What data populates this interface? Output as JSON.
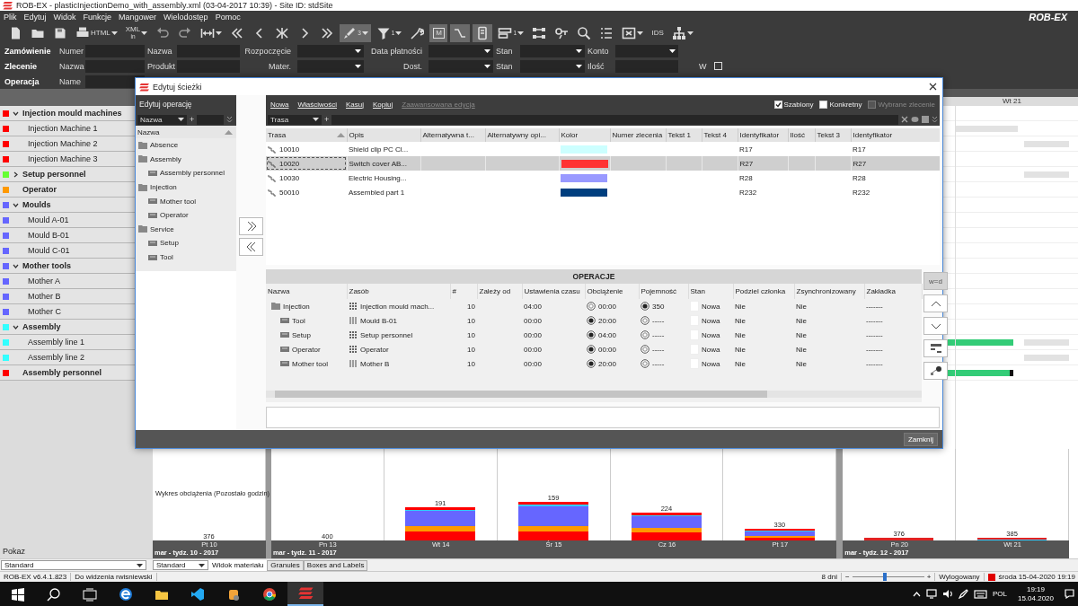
{
  "window": {
    "title": "ROB-EX - plasticInjectionDemo_with_assembly.xml (03-04-2017 10:39) - Site ID: stdSite"
  },
  "menu": {
    "items": [
      "Plik",
      "Edytuj",
      "Widok",
      "Funkcje",
      "Mangower",
      "Wielodostęp",
      "Pomoc"
    ],
    "logo": "ROB-EX"
  },
  "toolbar": [
    {
      "kind": "file",
      "on": false
    },
    {
      "kind": "folder",
      "on": false
    },
    {
      "kind": "save",
      "on": false
    },
    {
      "kind": "print",
      "text": "HTML",
      "dropdown": true,
      "on": false
    },
    {
      "kind": "xml",
      "text": "XML",
      "subtext": "in",
      "dropdown": true,
      "on": false
    },
    {
      "kind": "undo",
      "on": false
    },
    {
      "kind": "redo",
      "on": false
    },
    {
      "kind": "fit",
      "dropdown": true,
      "on": false
    },
    {
      "kind": "first",
      "on": false
    },
    {
      "kind": "prev",
      "on": false
    },
    {
      "kind": "center",
      "on": false
    },
    {
      "kind": "next",
      "on": false
    },
    {
      "kind": "last",
      "on": false
    },
    {
      "kind": "brush",
      "subtext": "3",
      "dropdown": true,
      "on": true
    },
    {
      "kind": "filter",
      "subtext": "1",
      "dropdown": true,
      "on": false
    },
    {
      "kind": "wrench",
      "on": false
    },
    {
      "kind": "mbox",
      "text": "M",
      "on": true
    },
    {
      "kind": "link",
      "on": true
    },
    {
      "kind": "phone",
      "on": true
    },
    {
      "kind": "list",
      "subtext": "1",
      "dropdown": true,
      "on": false
    },
    {
      "kind": "nodes",
      "on": false
    },
    {
      "kind": "key",
      "on": false
    },
    {
      "kind": "zoom",
      "on": false
    },
    {
      "kind": "list2",
      "on": false
    },
    {
      "kind": "frame",
      "dropdown": true,
      "on": false
    },
    {
      "kind": "ids",
      "text": "IDS",
      "on": false
    },
    {
      "kind": "tree",
      "dropdown": true,
      "on": false
    }
  ],
  "filters": [
    {
      "title": "Zamówienie",
      "fields": [
        {
          "label": "Numer",
          "kind": "text"
        },
        {
          "label": "Nazwa",
          "kind": "text"
        },
        {
          "label": "Rozpoczęcie",
          "kind": "dropdown"
        },
        {
          "label": "Data płatności",
          "kind": "dropdown"
        },
        {
          "label": "Stan",
          "kind": "dropdown"
        },
        {
          "label": "Konto",
          "kind": "dropdown"
        }
      ]
    },
    {
      "title": "Zlecenie",
      "fields": [
        {
          "label": "Nazwa",
          "kind": "text"
        },
        {
          "label": "Produkt",
          "kind": "text"
        },
        {
          "label": "Mater.",
          "kind": "dropdown"
        },
        {
          "label": "Dost.",
          "kind": "dropdown"
        },
        {
          "label": "Stan",
          "kind": "dropdown"
        },
        {
          "label": "Ilość",
          "kind": "text"
        },
        {
          "label": "W",
          "kind": "checkbox",
          "checked": false
        }
      ]
    },
    {
      "title": "Operacja",
      "fields": [
        {
          "label": "Name",
          "kind": "text"
        }
      ]
    }
  ],
  "resources": [
    {
      "name": "Injection mould machines",
      "color": "#ff0000",
      "expanded": true,
      "children": [
        {
          "name": "Injection Machine 1",
          "color": "#ff0000"
        },
        {
          "name": "Injection Machine 2",
          "color": "#ff0000"
        },
        {
          "name": "Injection Machine 3",
          "color": "#ff0000"
        }
      ]
    },
    {
      "name": "Setup personnel",
      "color": "#66ff33",
      "expanded": false
    },
    {
      "name": "Operator",
      "color": "#ff9900"
    },
    {
      "name": "Moulds",
      "color": "#6666ff",
      "expanded": true,
      "children": [
        {
          "name": "Mould A-01",
          "color": "#6666ff"
        },
        {
          "name": "Mould B-01",
          "color": "#6666ff"
        },
        {
          "name": "Mould C-01",
          "color": "#6666ff"
        }
      ]
    },
    {
      "name": "Mother tools",
      "color": "#6666ff",
      "expanded": true,
      "children": [
        {
          "name": "Mother A",
          "color": "#6666ff"
        },
        {
          "name": "Mother B",
          "color": "#6666ff"
        },
        {
          "name": "Mother C",
          "color": "#6666ff"
        }
      ]
    },
    {
      "name": "Assembly",
      "color": "#33ffff",
      "expanded": true,
      "children": [
        {
          "name": "Assembly line 1",
          "color": "#33ffff"
        },
        {
          "name": "Assembly line 2",
          "color": "#33ffff"
        }
      ]
    },
    {
      "name": "Assembly personnel",
      "color": "#ff0000"
    }
  ],
  "left_panel": {
    "label": "Pokaz",
    "dropdown": "Standard"
  },
  "gantt": {
    "day": "Wt 21"
  },
  "chart": {
    "title": "Wykres obciążenia (Pozostało godzin)",
    "weeks": [
      {
        "label": "mar - tydz. 10 - 2017",
        "days": [
          {
            "label": "Pt 10",
            "remaining": "376"
          }
        ]
      },
      {
        "label": "mar - tydz. 11 - 2017",
        "days": [
          {
            "label": "Pn 13",
            "remaining": "400"
          },
          {
            "label": "Wt 14",
            "remaining": "191"
          },
          {
            "label": "Śr 15",
            "remaining": "159"
          },
          {
            "label": "Cz 16",
            "remaining": "224"
          },
          {
            "label": "Pt 17",
            "remaining": "330"
          }
        ]
      },
      {
        "label": "mar - tydz. 12 - 2017",
        "days": [
          {
            "label": "Pn 20",
            "remaining": "376"
          },
          {
            "label": "Wt 21",
            "remaining": "385"
          }
        ]
      }
    ]
  },
  "view_tabs": {
    "dropdown": "Standard",
    "tabs": [
      {
        "label": "Widok materiału",
        "selected": true
      },
      {
        "label": "Granules",
        "selected": false
      },
      {
        "label": "Boxes and Labels",
        "selected": false
      }
    ]
  },
  "status_bar": {
    "version": "ROB-EX v6.4.1.823",
    "message": "Do widzenia rwisniewski",
    "range": "8 dni",
    "zoom_out": "−",
    "zoom_in": "+",
    "zoom": {
      "level": 0.45
    },
    "login": "Wylogowany",
    "datetime": "środa 15-04-2020 19:19"
  },
  "taskbar": {
    "buttons": [
      {
        "kind": "windows",
        "selected": false
      },
      {
        "kind": "search",
        "selected": false
      },
      {
        "kind": "taskview",
        "selected": false
      },
      {
        "kind": "edge",
        "selected": false
      },
      {
        "kind": "explorer",
        "selected": false
      },
      {
        "kind": "vscode",
        "selected": false
      },
      {
        "kind": "misc",
        "selected": false
      },
      {
        "kind": "chrome",
        "selected": false
      },
      {
        "kind": "robex",
        "selected": true
      }
    ],
    "language": "POL",
    "time": "19:19",
    "date": "15.04.2020"
  },
  "dialog": {
    "title": "Edytuj ścieżki",
    "left": {
      "header": "Edytuj operację",
      "dropdown": "Nazwa",
      "add": "+",
      "column": "Nazwa",
      "tree": [
        {
          "label": "Absence"
        },
        {
          "label": "Assembly",
          "children": [
            {
              "label": "Assembly personnel"
            }
          ]
        },
        {
          "label": "Injection",
          "children": [
            {
              "label": "Mother tool"
            },
            {
              "label": "Operator"
            }
          ]
        },
        {
          "label": "Service",
          "children": [
            {
              "label": "Setup"
            },
            {
              "label": "Tool"
            }
          ]
        }
      ]
    },
    "routes": {
      "actions": [
        {
          "label": "Nowa",
          "disabled": false
        },
        {
          "label": "Właściwości",
          "disabled": false
        },
        {
          "label": "Kasuj",
          "disabled": false
        },
        {
          "label": "Kopiuj",
          "disabled": false
        },
        {
          "label": "Zaawansowana edycja",
          "disabled": true
        }
      ],
      "options": [
        {
          "label": "Szablony",
          "checked": true,
          "disabled": false
        },
        {
          "label": "Konkretny",
          "checked": false,
          "disabled": false
        },
        {
          "label": "Wybrane zlecenie",
          "checked": false,
          "disabled": true
        }
      ],
      "dropdown": "Trasa",
      "add": "+",
      "columns": [
        "Trasa",
        "Opis",
        "Alternatywna t...",
        "Alternatywny opi...",
        "Kolor",
        "Numer zlecenia",
        "Tekst 1",
        "Tekst 4",
        "Identyfikator",
        "Ilość",
        "Tekst 3",
        "Identyfikator"
      ],
      "rows": [
        {
          "trasa": "10010",
          "opis": "Shield clip PC Cl...",
          "color": "#ccffff",
          "identyfikator": "R17",
          "identyfikator_2": "R17",
          "selected": false
        },
        {
          "trasa": "10020",
          "opis": "Switch cover AB...",
          "color": "#ff3333",
          "identyfikator": "R27",
          "identyfikator_2": "R27",
          "selected": true
        },
        {
          "trasa": "10030",
          "opis": "Electric Housing...",
          "color": "#9999ff",
          "identyfikator": "R28",
          "identyfikator_2": "R28",
          "selected": false
        },
        {
          "trasa": "50010",
          "opis": "Assembled part 1",
          "color": "#003f7f",
          "identyfikator": "R232",
          "identyfikator_2": "R232",
          "selected": false
        }
      ]
    },
    "operations": {
      "title": "OPERACJE",
      "side_button": {
        "label": "w=d",
        "disabled": true
      },
      "columns": [
        "Nazwa",
        "Zasób",
        "#",
        "Zależy od",
        "Ustawienia czasu",
        "Obciążenie",
        "Pojemność",
        "Stan",
        "Podziel członka",
        "Zsynchronizowany",
        "Zakładka"
      ],
      "rows": [
        {
          "name": "Injection",
          "resource": "Injection mould mach...",
          "kind": "group",
          "count": "10",
          "setup_time": "04:00",
          "load": {
            "text": "00:00",
            "selected": false
          },
          "capacity": {
            "text": "350",
            "selected": true
          },
          "status": "Nowa",
          "split": "Nie",
          "synchronized": "Nie",
          "tab": "-------",
          "children": [
            {
              "name": "Tool",
              "resource": "Mould B-01",
              "kind": "single",
              "count": "10",
              "setup_time": "00:00",
              "load": {
                "text": "20:00",
                "selected": true
              },
              "capacity": {
                "text": "-----",
                "selected": false
              },
              "status": "Nowa",
              "split": "Nie",
              "synchronized": "Nie",
              "tab": "-------"
            },
            {
              "name": "Setup",
              "resource": "Setup personnel",
              "kind": "group",
              "count": "10",
              "setup_time": "00:00",
              "load": {
                "text": "04:00",
                "selected": true
              },
              "capacity": {
                "text": "-----",
                "selected": false
              },
              "status": "Nowa",
              "split": "Nie",
              "synchronized": "Nie",
              "tab": "-------"
            },
            {
              "name": "Operator",
              "resource": "Operator",
              "kind": "group",
              "count": "10",
              "setup_time": "00:00",
              "load": {
                "text": "00:00",
                "selected": true
              },
              "capacity": {
                "text": "-----",
                "selected": false
              },
              "status": "Nowa",
              "split": "Nie",
              "synchronized": "Nie",
              "tab": "-------"
            },
            {
              "name": "Mother tool",
              "resource": "Mother B",
              "kind": "single",
              "count": "10",
              "setup_time": "00:00",
              "load": {
                "text": "20:00",
                "selected": true
              },
              "capacity": {
                "text": "-----",
                "selected": false
              },
              "status": "Nowa",
              "split": "Nie",
              "synchronized": "Nie",
              "tab": "-------"
            }
          ]
        }
      ]
    },
    "close_button": "Zamknij"
  }
}
